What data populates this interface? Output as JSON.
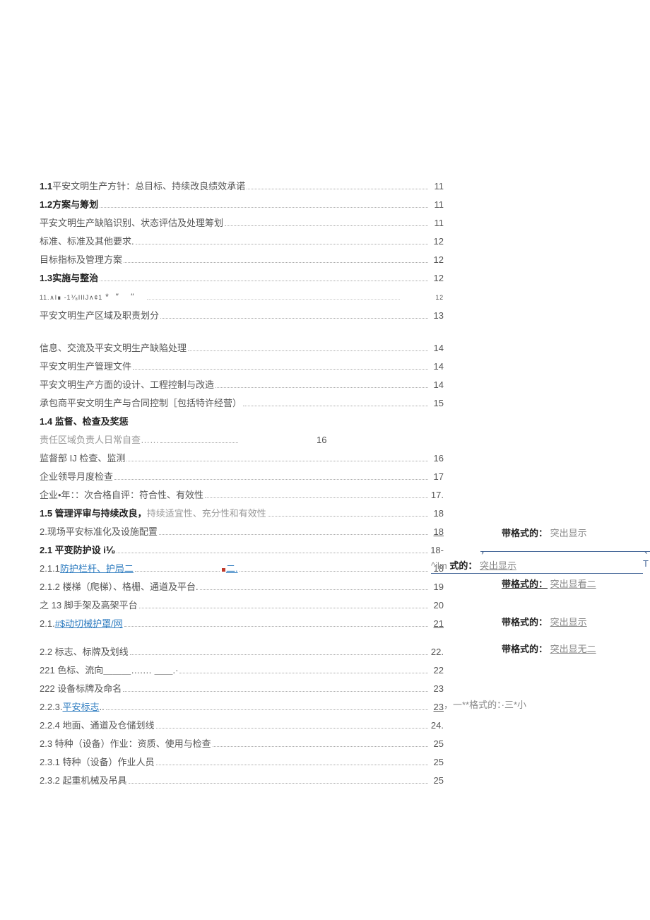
{
  "toc": {
    "r1": {
      "prefix": "1.1 ",
      "ptext": "平安文明生产方针：总目标、持续改良绩效承诺",
      "page": "11"
    },
    "r2": {
      "prefix": "1.2 ",
      "ptext": "方案与筹划",
      "page": "11"
    },
    "r3": {
      "text": "平安文明生产缺陷识别、状态评估及处理筹划",
      "page": "11"
    },
    "r4": {
      "text": "标准、标准及其他要求.",
      "page": "12"
    },
    "r5": {
      "text": "目标指标及管理方案",
      "page": "12"
    },
    "r6": {
      "prefix": "1.3 ",
      "ptext": "实施与整治",
      "page": "12"
    },
    "r7": {
      "garb": "11.∧I∎ -1⅟₈IIIJ∧¢1",
      "page": "12"
    },
    "r8": {
      "text": "平安文明生产区域及职责划分",
      "page": "13"
    },
    "r9": {
      "text": "信息、交流及平安文明生产缺陷处理",
      "page": "14"
    },
    "r10": {
      "text": "平安文明生产管理文件",
      "page": "14"
    },
    "r11": {
      "text": "平安文明生产方面的设计、工程控制与改造",
      "page": "14"
    },
    "r12": {
      "text": "承包商平安文明生产与合同控制［包括特许经营）",
      "page": "15"
    },
    "r13": {
      "text": "1.4 监督、检查及奖惩"
    },
    "r14": {
      "text": "责任区域负责人日常自查……",
      "page": "16"
    },
    "r15": {
      "text": "监督部 IJ 检查、监测",
      "page": "16"
    },
    "r16": {
      "text": "企业领导月度检查",
      "page": "17"
    },
    "r17": {
      "text": "企业•年：：次合格自评：符合性、有效性",
      "page": "17."
    },
    "r18": {
      "bold": "1.5 管理评审与持续改良，",
      "tail": "持续适宜性、充分性和有效性",
      "page": "18"
    },
    "r19": {
      "text": "2.现场平安标准化及设施配置",
      "page": "18",
      "underlinePage": true
    },
    "r20": {
      "bold": "2.1 平变防护设 i⅟₈",
      "page": "18-"
    },
    "r21": {
      "pre": "2.1.1 ",
      "link": "防护栏杆、护局二",
      "tail": "二.",
      "page": "18"
    },
    "r22": {
      "text": "2.1.2 楼梯（爬梯）、格栅、通道及平台.",
      "page": "19"
    },
    "r23": {
      "text": "之 13 脚手架及高架平台",
      "page": "20"
    },
    "r24": {
      "pre": "2.1.",
      "link": "#$动切械护罩/网",
      "page": "21",
      "underlinePage": true
    },
    "r25": {
      "text": "2.2 标志、标牌及划线",
      "page": "22."
    },
    "r26": {
      "text": "221 色标、流向＿＿＿….… ＿＿.·",
      "page": "22"
    },
    "r27": {
      "text": "222 设备标牌及命名",
      "page": "23"
    },
    "r28": {
      "pre": "2.2.3.",
      "link": "平安标志",
      "tail": "         ..",
      "page": "23",
      "underlinePage": true
    },
    "r29": {
      "text": "2.2.4 地面、通道及仓储划线",
      "page": "24."
    },
    "r30": {
      "text": "2.3 特种（设备）作业：资质、使用与检查",
      "page": "25"
    },
    "r31": {
      "text": "2.3.1 特种（设备）作业人员",
      "page": "25"
    },
    "r32": {
      "text": "2.3.2 起重机械及吊具",
      "page": "25"
    }
  },
  "annotations": {
    "a1": {
      "prefix": "带格式的：",
      "text": "突出显示"
    },
    "a2": {
      "pre": "^jlm ",
      "mid": "式的：",
      "text": "突出显示",
      "tail": "T"
    },
    "a3": {
      "prefix": "带格式的：",
      "text": "突出显看二"
    },
    "a4": {
      "prefix": "带格式的：",
      "text": "突出显示"
    },
    "a5": {
      "prefix": "带格式的：",
      "text": "突出显无二"
    },
    "a6": {
      "pre": "，一**格式的：·三*小"
    }
  }
}
